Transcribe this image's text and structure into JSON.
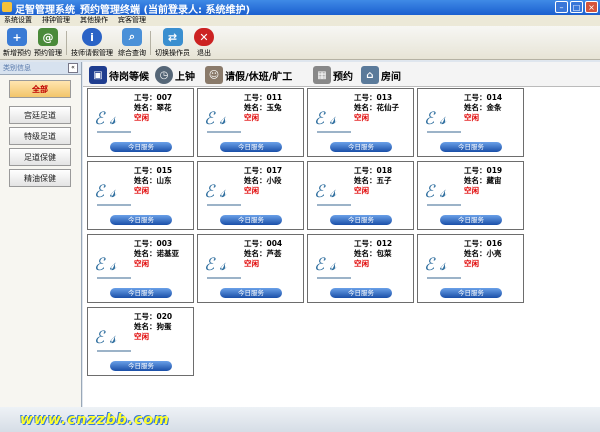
{
  "window": {
    "title": "足智管理系统_预约管理终端  (当前登录人: 系统维护)"
  },
  "menu": [
    "系统设置",
    "排钟管理",
    "其他操作",
    "宾客管理"
  ],
  "toolbar": [
    {
      "label": "新增预约",
      "icon": "add-user-icon",
      "color": "#3a7bd5"
    },
    {
      "label": "预约管理",
      "icon": "email-icon",
      "color": "#4a8a3a"
    },
    {
      "label": "技师请假管理",
      "icon": "info-icon",
      "color": "#2b63c6"
    },
    {
      "label": "综合查询",
      "icon": "search-icon",
      "color": "#4a90d8"
    },
    {
      "label": "切换操作员",
      "icon": "switch-user-icon",
      "color": "#3a8fd0"
    },
    {
      "label": "退出",
      "icon": "close-circle-icon",
      "color": "#cc2222"
    }
  ],
  "sidebar": {
    "title": "类别信息",
    "items": [
      "全部",
      "宫廷足道",
      "特级足道",
      "足道保健",
      "精油保健"
    ]
  },
  "tabs": [
    {
      "label": "待岗等候",
      "icon": "waiting-icon",
      "color": "#1f3d8f"
    },
    {
      "label": "上钟",
      "icon": "clock-icon",
      "color": "#556677"
    },
    {
      "label": "请假/休班/旷工",
      "icon": "person-icon",
      "color": "#8a7a6a"
    },
    {
      "label": "预约",
      "icon": "calendar-icon",
      "color": "#888888"
    },
    {
      "label": "房间",
      "icon": "house-icon",
      "color": "#5a7a9a"
    }
  ],
  "cards": [
    {
      "id": "工号：007",
      "name": "姓名：翠花",
      "status": "空闲",
      "button": "今日服务"
    },
    {
      "id": "工号：011",
      "name": "姓名：玉兔",
      "status": "空闲",
      "button": "今日服务"
    },
    {
      "id": "工号：013",
      "name": "姓名：花仙子",
      "status": "空闲",
      "button": "今日服务"
    },
    {
      "id": "工号：014",
      "name": "姓名：金条",
      "status": "空闲",
      "button": "今日服务"
    },
    {
      "id": "工号：015",
      "name": "姓名：山东",
      "status": "空闲",
      "button": "今日服务"
    },
    {
      "id": "工号：017",
      "name": "姓名：小段",
      "status": "空闲",
      "button": "今日服务"
    },
    {
      "id": "工号：018",
      "name": "姓名：五子",
      "status": "空闲",
      "button": "今日服务"
    },
    {
      "id": "工号：019",
      "name": "姓名：藏宙",
      "status": "空闲",
      "button": "今日服务"
    },
    {
      "id": "工号：003",
      "name": "姓名：诺基亚",
      "status": "空闲",
      "button": "今日服务"
    },
    {
      "id": "工号：004",
      "name": "姓名：芦荟",
      "status": "空闲",
      "button": "今日服务"
    },
    {
      "id": "工号：012",
      "name": "姓名：包菜",
      "status": "空闲",
      "button": "今日服务"
    },
    {
      "id": "工号：016",
      "name": "姓名：小亮",
      "status": "空闲",
      "button": "今日服务"
    },
    {
      "id": "工号：020",
      "name": "姓名：狗蛋",
      "status": "空闲",
      "button": "今日服务"
    }
  ],
  "watermark": "www.cnzzbb.com"
}
